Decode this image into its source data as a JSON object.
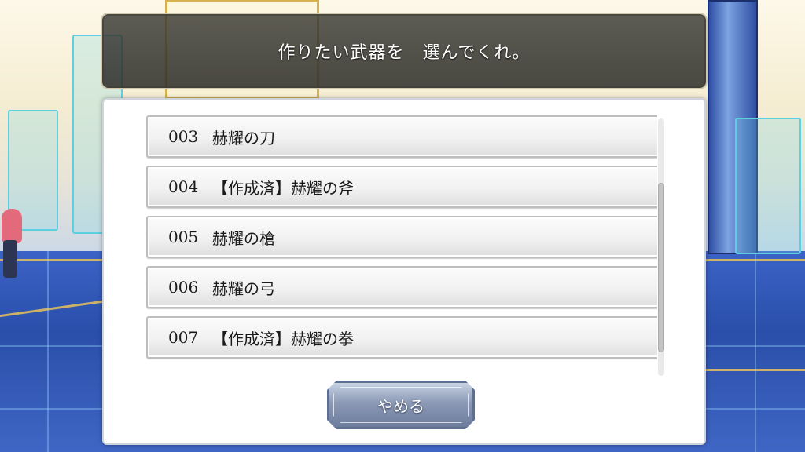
{
  "dialog": {
    "prompt": "作りたい武器を　選んでくれ。"
  },
  "weapon_list": {
    "items": [
      {
        "number": "003",
        "name": "赫耀の刀"
      },
      {
        "number": "004",
        "name": "【作成済】赫耀の斧"
      },
      {
        "number": "005",
        "name": "赫耀の槍"
      },
      {
        "number": "006",
        "name": "赫耀の弓"
      },
      {
        "number": "007",
        "name": "【作成済】赫耀の拳"
      }
    ]
  },
  "buttons": {
    "cancel_label": "やめる"
  },
  "colors": {
    "message_bg": "#3a3a34",
    "panel_bg": "#ffffff",
    "cancel_button": "#8b99b5",
    "floor": "#3b63c7"
  }
}
